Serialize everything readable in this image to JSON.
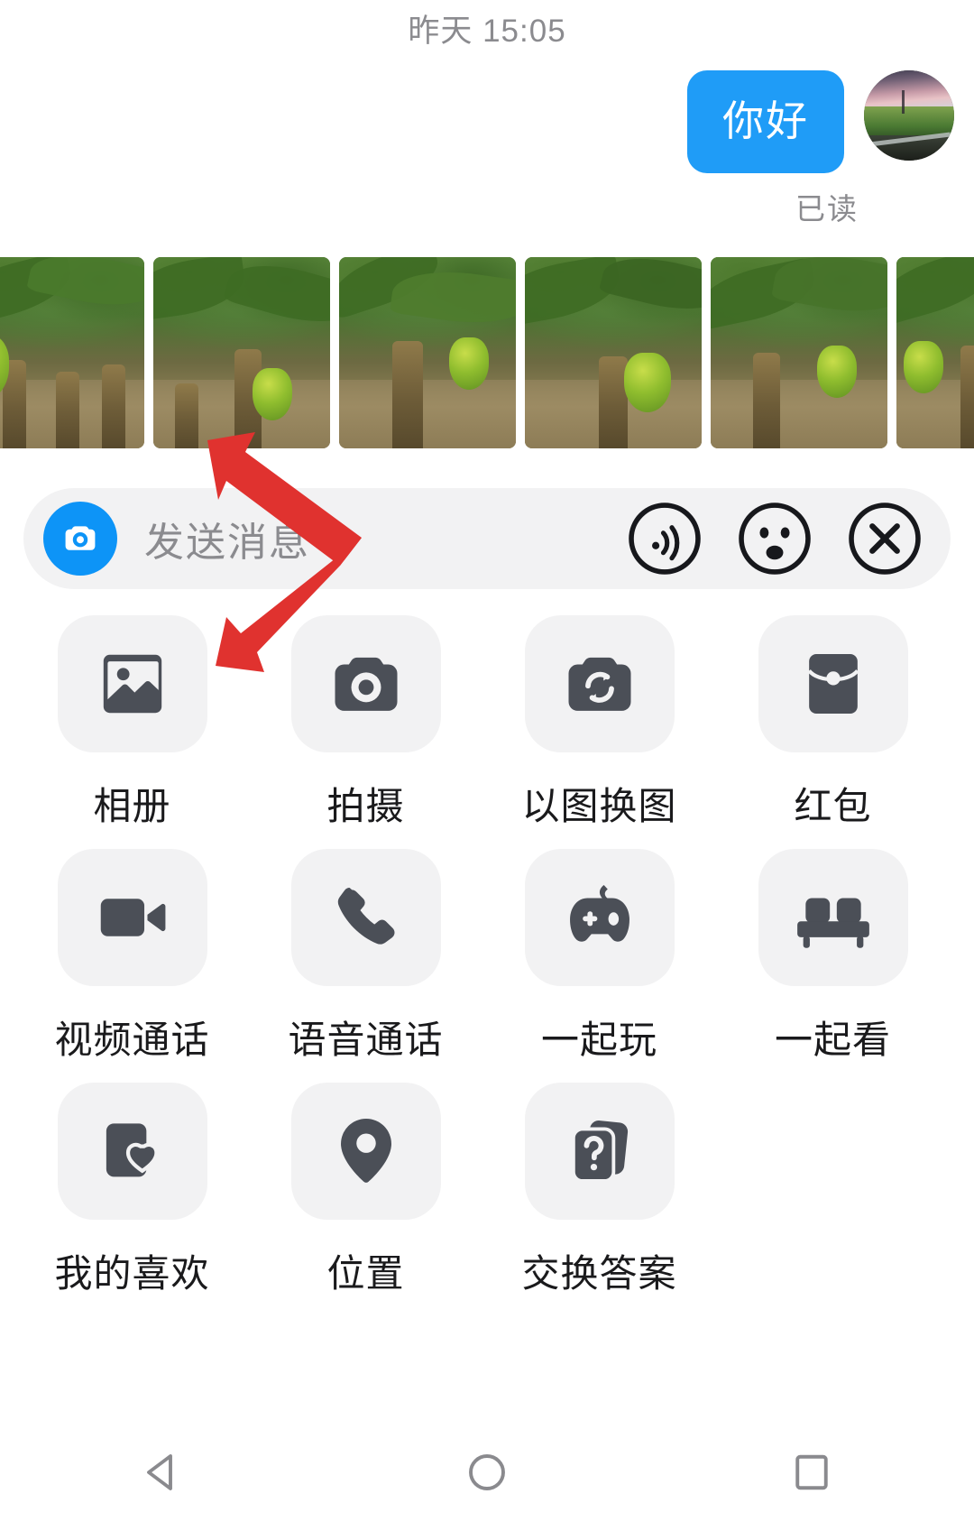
{
  "conversation": {
    "timestamp": "昨天 15:05",
    "outgoing_message": "你好",
    "read_receipt": "已读",
    "avatar_name": "sunset-landscape-avatar",
    "photos": [
      {
        "name": "banana-plantation-photo-1"
      },
      {
        "name": "banana-plantation-photo-2"
      },
      {
        "name": "banana-plantation-photo-3"
      },
      {
        "name": "banana-plantation-photo-4"
      },
      {
        "name": "banana-plantation-photo-5"
      },
      {
        "name": "banana-plantation-photo-6"
      }
    ]
  },
  "input_bar": {
    "placeholder": "发送消息",
    "camera_button_icon": "camera-icon",
    "camera_button_color": "#0d94f7",
    "actions": [
      {
        "icon": "voice-wave-icon",
        "name": "voice-input-button"
      },
      {
        "icon": "emoji-face-icon",
        "name": "emoji-button"
      },
      {
        "icon": "close-x-icon",
        "name": "close-panel-button"
      }
    ]
  },
  "attachment_panel": {
    "items": [
      {
        "label": "相册",
        "icon": "image-gallery-icon",
        "name": "album"
      },
      {
        "label": "拍摄",
        "icon": "camera-icon",
        "name": "capture"
      },
      {
        "label": "以图换图",
        "icon": "camera-refresh-icon",
        "name": "image-swap"
      },
      {
        "label": "红包",
        "icon": "red-packet-icon",
        "name": "red-packet"
      },
      {
        "label": "视频通话",
        "icon": "video-camera-icon",
        "name": "video-call"
      },
      {
        "label": "语音通话",
        "icon": "phone-icon",
        "name": "voice-call"
      },
      {
        "label": "一起玩",
        "icon": "gamepad-icon",
        "name": "play-together"
      },
      {
        "label": "一起看",
        "icon": "sofa-icon",
        "name": "watch-together"
      },
      {
        "label": "我的喜欢",
        "icon": "heart-card-icon",
        "name": "my-favorites"
      },
      {
        "label": "位置",
        "icon": "location-pin-icon",
        "name": "location"
      },
      {
        "label": "交换答案",
        "icon": "question-cards-icon",
        "name": "exchange-answers"
      }
    ]
  },
  "annotation": {
    "arrow_color": "#e0322f",
    "name": "red-double-arrow-annotation"
  },
  "navigation_bar": {
    "back": "back-triangle-icon",
    "home": "home-circle-icon",
    "recents": "recents-square-icon"
  },
  "colors": {
    "accent_blue": "#1f9cf7",
    "tile_bg": "#f2f2f3",
    "icon_dark": "#4b4f57",
    "muted_text": "#8b8b8f"
  }
}
